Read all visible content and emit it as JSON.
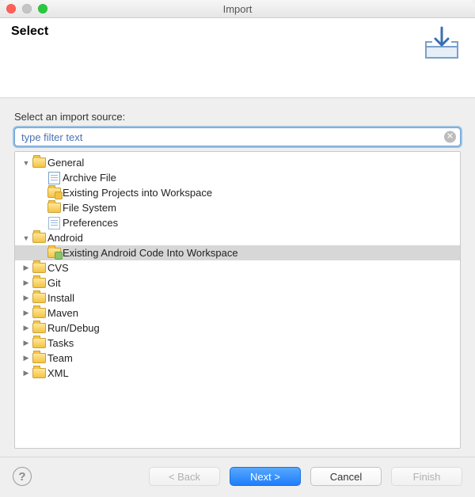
{
  "window": {
    "title": "Import"
  },
  "banner": {
    "title": "Select"
  },
  "body": {
    "label": "Select an import source:",
    "filter_placeholder": "type filter text"
  },
  "tree": {
    "general": {
      "label": "General",
      "archive_file": "Archive File",
      "existing_projects": "Existing Projects into Workspace",
      "file_system": "File System",
      "preferences": "Preferences"
    },
    "android": {
      "label": "Android",
      "existing_code": "Existing Android Code Into Workspace"
    },
    "cvs": {
      "label": "CVS"
    },
    "git": {
      "label": "Git"
    },
    "install": {
      "label": "Install"
    },
    "maven": {
      "label": "Maven"
    },
    "rundebug": {
      "label": "Run/Debug"
    },
    "tasks": {
      "label": "Tasks"
    },
    "team": {
      "label": "Team"
    },
    "xml": {
      "label": "XML"
    }
  },
  "buttons": {
    "back": "< Back",
    "next": "Next >",
    "cancel": "Cancel",
    "finish": "Finish"
  }
}
